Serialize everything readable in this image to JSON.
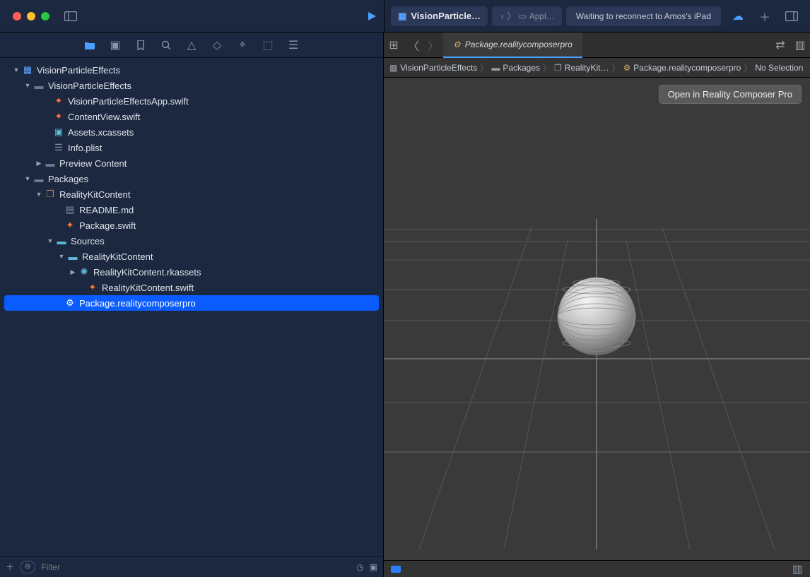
{
  "toolbar": {
    "scheme": "VisionParticle…",
    "device_label": "Appl…",
    "status": "Waiting to reconnect to Amos's iPad"
  },
  "tabs": {
    "open_file": "Package.realitycomposerpro"
  },
  "jumpbar": {
    "items": [
      "VisionParticleEffects",
      "Packages",
      "RealityKit…",
      "Package.realitycomposerpro",
      "No Selection"
    ]
  },
  "open_button": "Open in Reality Composer Pro",
  "filter_placeholder": "Filter",
  "tree": {
    "root": "VisionParticleEffects",
    "g0": "VisionParticleEffects",
    "f0": "VisionParticleEffectsApp.swift",
    "f1": "ContentView.swift",
    "f2": "Assets.xcassets",
    "f3": "Info.plist",
    "g1": "Preview Content",
    "g2": "Packages",
    "g3": "RealityKitContent",
    "f4": "README.md",
    "f5": "Package.swift",
    "g4": "Sources",
    "g5": "RealityKitContent",
    "f6": "RealityKitContent.rkassets",
    "f7": "RealityKitContent.swift",
    "f8": "Package.realitycomposerpro"
  }
}
